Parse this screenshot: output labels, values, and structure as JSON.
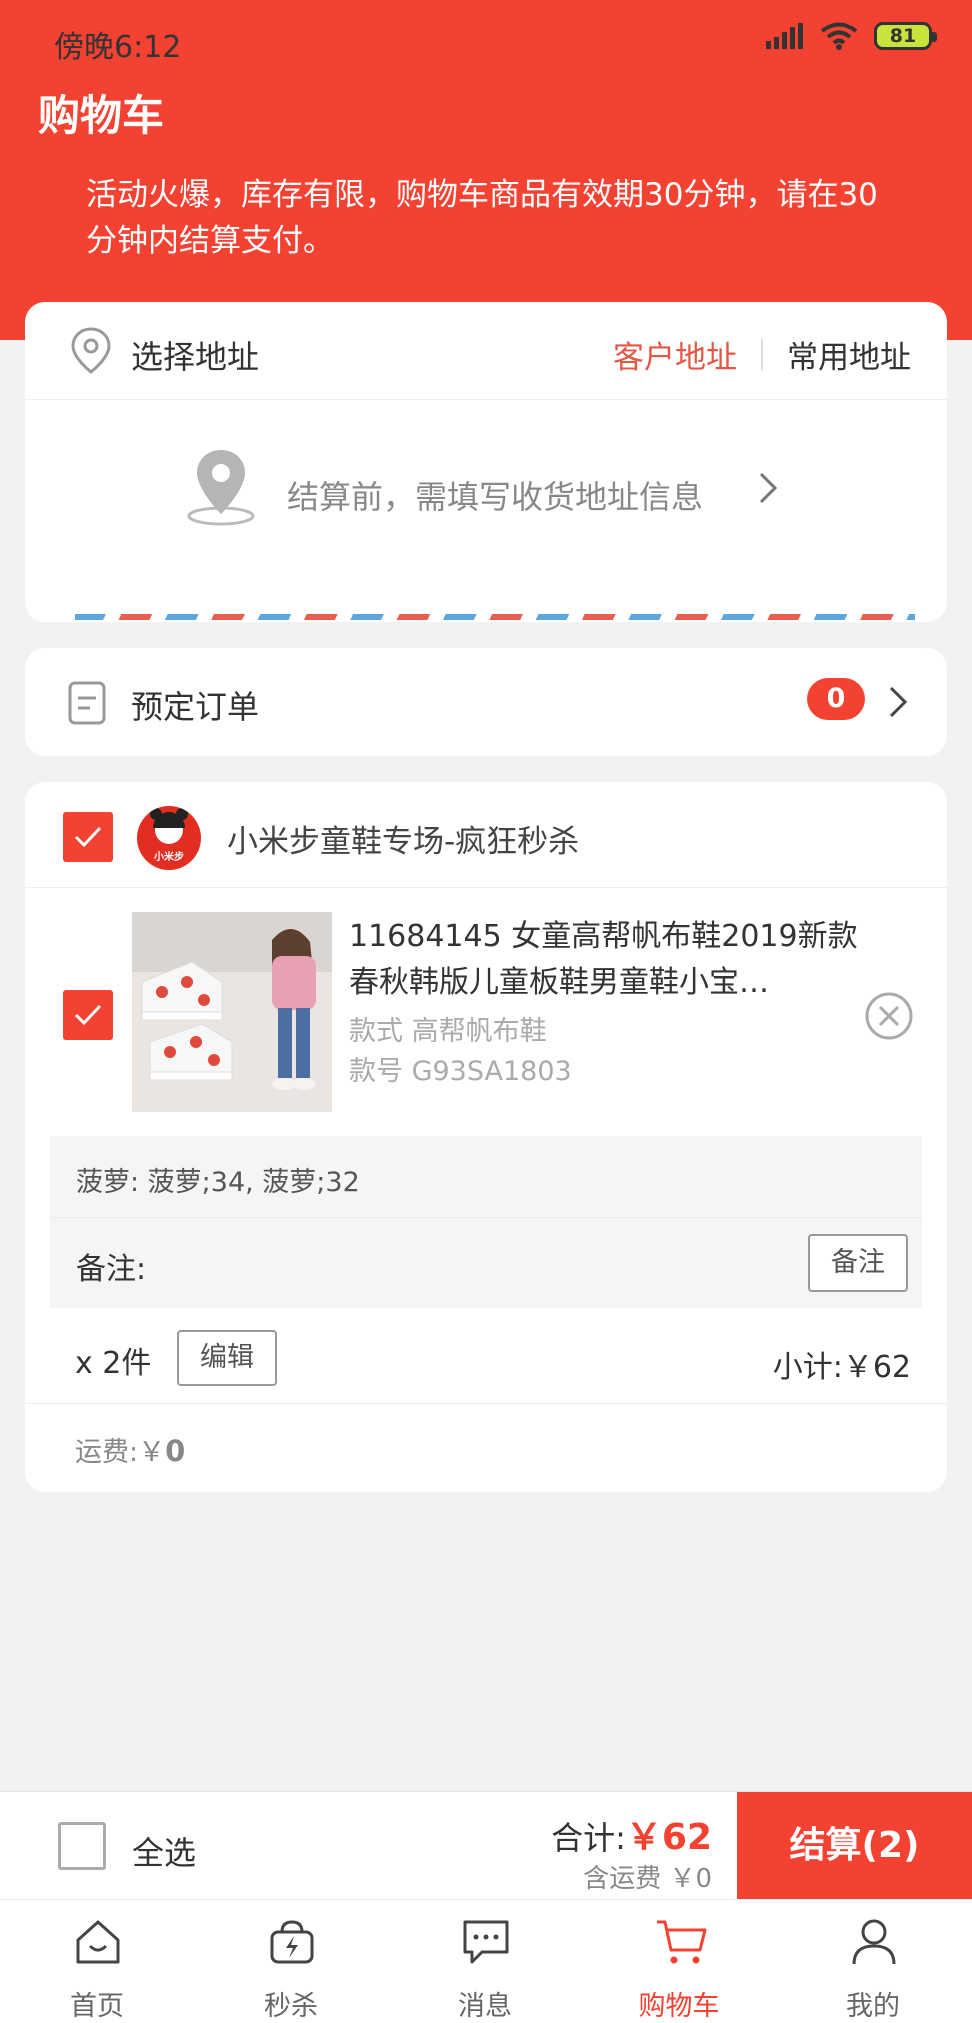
{
  "status": {
    "time": "傍晚6:12",
    "battery": "81"
  },
  "header": {
    "title": "购物车",
    "notice": "活动火爆，库存有限，购物车商品有效期30分钟，请在30分钟内结算支付。"
  },
  "address": {
    "title": "选择地址",
    "tab_customer": "客户地址",
    "tab_common": "常用地址",
    "hint": "结算前，需填写收货地址信息"
  },
  "reserve": {
    "label": "预定订单",
    "count": "0"
  },
  "shop": {
    "name": "小米步童鞋专场-疯狂秒杀",
    "logo_text": "小米步",
    "item": {
      "title": "11684145 女童高帮帆布鞋2019新款春秋韩版儿童板鞋男童鞋小宝…",
      "style": "款式 高帮帆布鞋",
      "code": "款号 G93SA1803"
    },
    "spec": "菠萝: 菠萝;34, 菠萝;32",
    "remark_label": "备注:",
    "remark_button": "备注",
    "quantity": "x 2件",
    "edit_button": "编辑",
    "subtotal": "小计:￥62",
    "shipping_label": "运费:￥",
    "shipping_value": "0"
  },
  "bottom": {
    "select_all": "全选",
    "total_label": "合计:",
    "total_amount": "￥62",
    "shipping_included": "含运费 ￥0",
    "checkout": "结算(2)"
  },
  "tabs": [
    {
      "label": "首页",
      "icon": "home-icon"
    },
    {
      "label": "秒杀",
      "icon": "flash-sale-icon"
    },
    {
      "label": "消息",
      "icon": "message-icon"
    },
    {
      "label": "购物车",
      "icon": "cart-icon"
    },
    {
      "label": "我的",
      "icon": "user-icon"
    }
  ],
  "colors": {
    "brand": "#f44232",
    "accent_text": "#e25845"
  }
}
